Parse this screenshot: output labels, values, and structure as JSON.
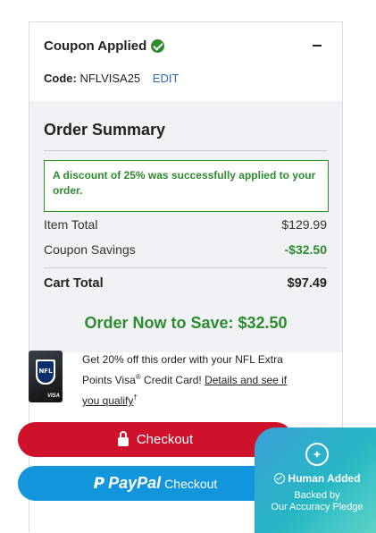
{
  "coupon": {
    "title": "Coupon Applied",
    "code_label": "Code:",
    "code_value": "NFLVISA25",
    "edit_label": "EDIT"
  },
  "summary": {
    "title": "Order Summary",
    "discount_message": "A discount of 25% was successfully applied to your order.",
    "item_total_label": "Item Total",
    "item_total_value": "$129.99",
    "coupon_savings_label": "Coupon Savings",
    "coupon_savings_value": "-$32.50",
    "cart_total_label": "Cart Total",
    "cart_total_value": "$97.49",
    "save_now": "Order Now to Save: $32.50"
  },
  "promo": {
    "text_before": "Get 20% off this order with your NFL Extra Points Visa",
    "registered": "®",
    "text_mid": " Credit Card! ",
    "link": "Details and see if you qualify",
    "dagger": "†",
    "card_logo_text": "NFL",
    "card_network": "VISA"
  },
  "buttons": {
    "checkout_label": "Checkout",
    "paypal_mark": "P",
    "paypal_word": "PayPal",
    "paypal_label": "Checkout"
  },
  "badge": {
    "title": "Human Added",
    "subtitle_line1": "Backed by",
    "subtitle_line2": "Our Accuracy Pledge"
  },
  "colors": {
    "success_green": "#2e8b2e",
    "checkout_red": "#d0112b",
    "paypal_blue": "#1295db",
    "link_blue": "#2b6cb0",
    "summary_bg": "#f0f2f5"
  },
  "icons": [
    "check-circle-icon",
    "minus-icon",
    "lock-icon",
    "paypal-logo-icon",
    "human-badge-icon",
    "check-badge-icon"
  ]
}
